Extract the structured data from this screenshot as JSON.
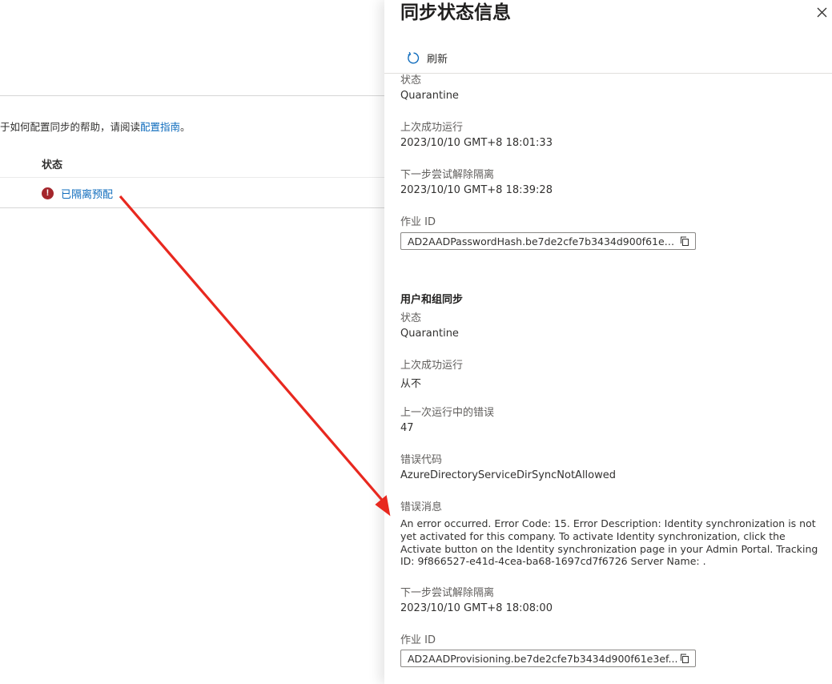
{
  "background": {
    "help_text": "于如何配置同步的帮助，请阅读",
    "help_link": "配置指南",
    "help_suffix": "。",
    "column_status": "状态",
    "row_status": "已隔离预配"
  },
  "panel": {
    "title": "同步状态信息",
    "toolbar": {
      "refresh_label": "刷新"
    },
    "password_hash_sync": {
      "status_label": "状态",
      "status_value": "Quarantine",
      "last_success_label": "上次成功运行",
      "last_success_value": "2023/10/10 GMT+8 18:01:33",
      "next_attempt_label": "下一步尝试解除隔离",
      "next_attempt_value": "2023/10/10 GMT+8 18:39:28",
      "job_id_label": "作业 ID",
      "job_id_value": "AD2AADPasswordHash.be7de2cfe7b3434d900f61e3..."
    },
    "user_group_sync": {
      "title": "用户和组同步",
      "status_label": "状态",
      "status_value": "Quarantine",
      "last_success_label": "上次成功运行",
      "last_success_value": "从不",
      "errors_label": "上一次运行中的错误",
      "errors_value": "47",
      "error_code_label": "错误代码",
      "error_code_value": "AzureDirectoryServiceDirSyncNotAllowed",
      "error_message_label": "错误消息",
      "error_message_value": "An error occurred. Error Code: 15. Error Description: Identity synchronization is not yet activated for this company. To activate Identity synchronization, click the Activate button on the Identity synchronization page in your Admin Portal. Tracking ID: 9f866527-e41d-4cea-ba68-1697cd7f6726 Server Name: .",
      "next_attempt_label": "下一步尝试解除隔离",
      "next_attempt_value": "2023/10/10 GMT+8 18:08:00",
      "job_id_label": "作业 ID",
      "job_id_value": "AD2AADProvisioning.be7de2cfe7b3434d900f61e3ef..."
    }
  },
  "colors": {
    "link": "#0f6cbd",
    "error_icon": "#a4262c",
    "annotation_arrow": "#e8281f"
  },
  "icons": {
    "error": "exclamation-circle-icon",
    "refresh": "refresh-icon",
    "close": "close-icon",
    "copy": "copy-icon"
  }
}
